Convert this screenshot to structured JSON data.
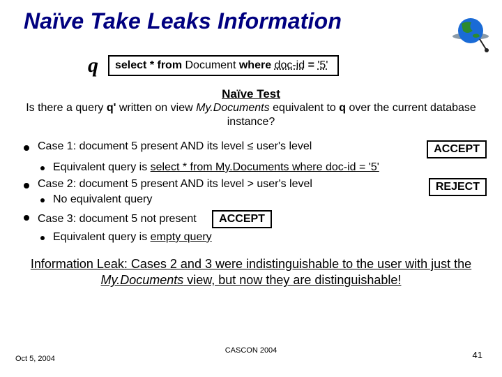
{
  "title": "Naïve Take Leaks Information",
  "q_label": "q",
  "query": {
    "pre": "select * from ",
    "tbl": "Document",
    "mid": " where ",
    "cond_left": "doc-id",
    "eq": " = ",
    "cond_right": "'5'"
  },
  "naive_test_heading": "Naïve Test",
  "naive_test_body": {
    "p1": "Is there a query ",
    "qprime": "q'",
    "p2": " written on view ",
    "view": "My.Documents",
    "p3": " equivalent to ",
    "qref": "q",
    "p4": " over the current database instance?"
  },
  "cases": {
    "c1": {
      "text": "Case 1: document 5 present AND its level ≤ user's level",
      "badge": "ACCEPT",
      "sub_pre": "Equivalent  query is ",
      "sub_u": "select * from My.Documents where doc-id = '5'"
    },
    "c2": {
      "text": "Case 2: document 5 present AND its level > user's level",
      "badge": "REJECT",
      "sub": "No equivalent query"
    },
    "c3": {
      "text": "Case 3: document 5 not present",
      "badge": "ACCEPT",
      "sub_pre": "Equivalent  query is ",
      "sub_u": "empty query"
    }
  },
  "leak": {
    "p1": "Information Leak: Cases 2 and 3 were indistinguishable to the user with just the ",
    "view": "My.Documents",
    "p2": " view, but now they are distinguishable!"
  },
  "footer": {
    "left": "Oct 5, 2004",
    "center": "CASCON 2004",
    "right": "41"
  }
}
